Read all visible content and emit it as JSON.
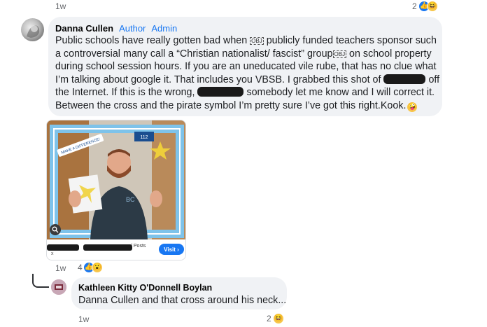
{
  "top": {
    "time": "1w",
    "reaction_count": "2"
  },
  "comment": {
    "author": "Danna Cullen",
    "badges": [
      "Author",
      "Admin"
    ],
    "segments": {
      "s1": "Public schools have really gotten bad when ",
      "s2": " publicly funded teachers sponsor such",
      "s3": "a controversial many call a “Christian nationalist/ fascist” group",
      "s4": " on school property",
      "s5": "during school session hours. If you are an uneducated vile rube, that has no clue what",
      "s6": "I’m talking about google it. That includes you VBSB. I grabbed this shot of",
      "s7": " off",
      "s8": "the Internet. If this is the wrong,",
      "s9": " somebody let me know and I will correct it.",
      "s10": "Between the cross and the pirate symbol I’m pretty sure I’ve got this right.Kook.",
      "glyph": "OBJ"
    },
    "time": "1w",
    "reaction_count": "4"
  },
  "image_card": {
    "frame_text": "MAKE A DIFFERENCE!",
    "frame_badge": "112",
    "shirt_logo": "BC",
    "posts_label": "/ Posts",
    "visit_label": "Visit ›",
    "x_label": "x"
  },
  "reply": {
    "author": "Kathleen Kitty O'Donnell Boylan",
    "text": "Danna Cullen and that cross around his neck...",
    "time": "1w",
    "reaction_count": "2"
  },
  "icons": {
    "like": "like-icon",
    "haha": "haha-icon",
    "wow": "wow-icon",
    "zoom": "zoom-icon"
  },
  "colors": {
    "accent": "#1877f2",
    "bubble": "#f0f2f5",
    "meta": "#65676b"
  }
}
